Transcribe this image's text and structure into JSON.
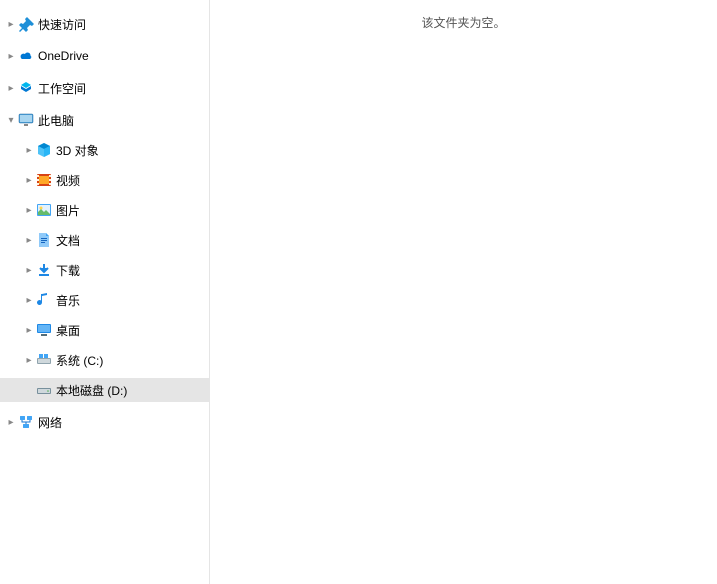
{
  "sidebar": {
    "quick_access": {
      "label": "快速访问"
    },
    "onedrive": {
      "label": "OneDrive"
    },
    "workspace": {
      "label": "工作空间"
    },
    "this_pc": {
      "label": "此电脑"
    },
    "objects_3d": {
      "label": "3D 对象"
    },
    "videos": {
      "label": "视频"
    },
    "pictures": {
      "label": "图片"
    },
    "documents": {
      "label": "文档"
    },
    "downloads": {
      "label": "下载"
    },
    "music": {
      "label": "音乐"
    },
    "desktop": {
      "label": "桌面"
    },
    "system_drive": {
      "label": "系统 (C:)"
    },
    "local_disk": {
      "label": "本地磁盘 (D:)"
    },
    "network": {
      "label": "网络"
    }
  },
  "main": {
    "empty_folder_message": "该文件夹为空。"
  }
}
